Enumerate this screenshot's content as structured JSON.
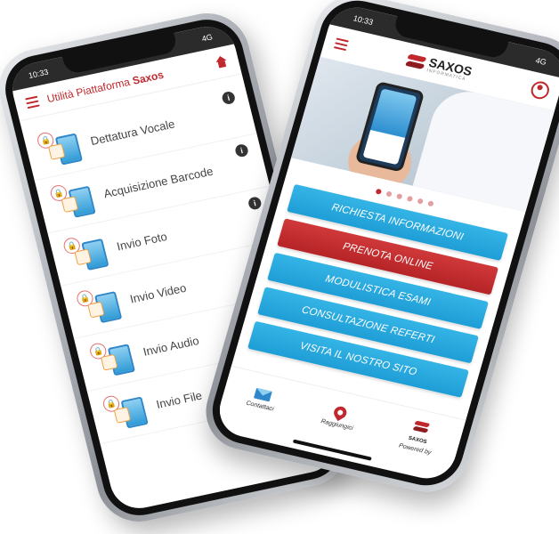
{
  "left_phone": {
    "status_time": "10:33",
    "status_right": "4G",
    "title_prefix": "Utilità Piattaforma",
    "title_brand": "Saxos",
    "menu_items": [
      {
        "label": "Dettatura Vocale",
        "info": "i"
      },
      {
        "label": "Acquisizione Barcode",
        "info": "i"
      },
      {
        "label": "Invio Foto",
        "info": "i"
      },
      {
        "label": "Invio Video",
        "info": "i"
      },
      {
        "label": "Invio Audio",
        "info": ""
      },
      {
        "label": "Invio File",
        "info": ""
      }
    ]
  },
  "right_phone": {
    "status_time": "10:33",
    "status_right": "4G",
    "logo_text": "SAXOS",
    "logo_sub": "INFORMATICA",
    "carousel_dots": 6,
    "active_dot": 1,
    "buttons": [
      {
        "label": "RICHIESTA INFORMAZIONI",
        "color": "#1e9ed6"
      },
      {
        "label": "PRENOTA ONLINE",
        "color": "#b62427"
      },
      {
        "label": "MODULISTICA ESAMI",
        "color": "#1e9ed6"
      },
      {
        "label": "CONSULTAZIONE REFERTI",
        "color": "#1e9ed6"
      },
      {
        "label": "VISITA IL NOSTRO SITO",
        "color": "#1e9ed6"
      }
    ],
    "bottom_nav": {
      "contacts_label": "Contattaci",
      "reach_label": "Raggiungici",
      "powered_brand": "SAXOS",
      "powered_label": "Powered by"
    }
  },
  "colors": {
    "brand_red": "#c0282d",
    "button_blue": "#1e9ed6"
  }
}
